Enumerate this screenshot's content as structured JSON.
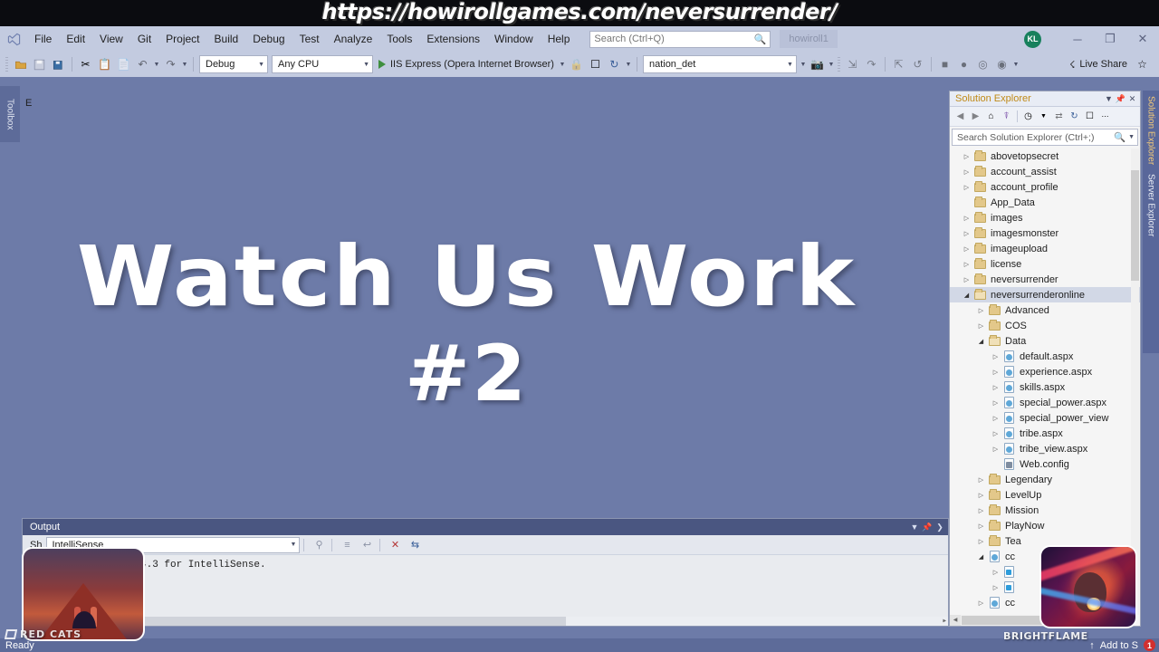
{
  "banner": {
    "url": "https://howirollgames.com/neversurrender/"
  },
  "menubar": {
    "logo_icon": "visual-studio-logo-icon",
    "items": [
      "File",
      "Edit",
      "View",
      "Git",
      "Project",
      "Build",
      "Debug",
      "Test",
      "Analyze",
      "Tools",
      "Extensions",
      "Window",
      "Help"
    ],
    "search_placeholder": "Search (Ctrl+Q)",
    "search_icon": "search-icon",
    "project_name": "howiroll1",
    "avatar_initials": "KL",
    "window_minimize": "─",
    "window_restore": "❐",
    "window_close": "✕"
  },
  "toolbar": {
    "icons": [
      "open-file-icon",
      "save-icon",
      "save-all-icon",
      "cut-icon",
      "copy-icon",
      "paste-icon",
      "undo-icon",
      "redo-icon"
    ],
    "config_value": "Debug",
    "platform_value": "Any CPU",
    "run_label": "IIS Express (Opera Internet Browser)",
    "startup_value": "nation_det",
    "live_share_label": "Live Share",
    "live_share_icon": "live-share-icon"
  },
  "workspace": {
    "toolbox_tab": "Toolbox",
    "hero_line1": "Watch Us Work",
    "hero_line2": "#2"
  },
  "solution_explorer": {
    "title": "Solution Explorer",
    "title_color": "#c08a17",
    "dropdown_icon": "chevron-down-icon",
    "pin_icon": "pin-icon",
    "close_icon": "close-icon",
    "toolbar_icons": [
      "back-icon",
      "forward-icon",
      "home-icon",
      "pending-changes-icon",
      "preview-icon",
      "sync-icon",
      "refresh-icon",
      "collapse-all-icon",
      "properties-icon"
    ],
    "search_placeholder": "Search Solution Explorer (Ctrl+;)",
    "search_icon": "search-icon",
    "tree": [
      {
        "label": "abovetopsecret",
        "indent": 1,
        "icon": "folder",
        "arrow": "closed"
      },
      {
        "label": "account_assist",
        "indent": 1,
        "icon": "folder",
        "arrow": "closed"
      },
      {
        "label": "account_profile",
        "indent": 1,
        "icon": "folder",
        "arrow": "closed"
      },
      {
        "label": "App_Data",
        "indent": 1,
        "icon": "folder",
        "arrow": "none"
      },
      {
        "label": "images",
        "indent": 1,
        "icon": "folder",
        "arrow": "closed"
      },
      {
        "label": "imagesmonster",
        "indent": 1,
        "icon": "folder",
        "arrow": "closed"
      },
      {
        "label": "imageupload",
        "indent": 1,
        "icon": "folder",
        "arrow": "closed"
      },
      {
        "label": "license",
        "indent": 1,
        "icon": "folder",
        "arrow": "closed"
      },
      {
        "label": "neversurrender",
        "indent": 1,
        "icon": "folder",
        "arrow": "closed"
      },
      {
        "label": "neversurrenderonline",
        "indent": 1,
        "icon": "folder-open",
        "arrow": "open",
        "selected": true
      },
      {
        "label": "Advanced",
        "indent": 2,
        "icon": "folder",
        "arrow": "closed"
      },
      {
        "label": "COS",
        "indent": 2,
        "icon": "folder",
        "arrow": "closed"
      },
      {
        "label": "Data",
        "indent": 2,
        "icon": "folder-open",
        "arrow": "open"
      },
      {
        "label": "default.aspx",
        "indent": 3,
        "icon": "aspx",
        "arrow": "closed"
      },
      {
        "label": "experience.aspx",
        "indent": 3,
        "icon": "aspx",
        "arrow": "closed"
      },
      {
        "label": "skills.aspx",
        "indent": 3,
        "icon": "aspx",
        "arrow": "closed"
      },
      {
        "label": "special_power.aspx",
        "indent": 3,
        "icon": "aspx",
        "arrow": "closed"
      },
      {
        "label": "special_power_view",
        "indent": 3,
        "icon": "aspx",
        "arrow": "closed"
      },
      {
        "label": "tribe.aspx",
        "indent": 3,
        "icon": "aspx",
        "arrow": "closed"
      },
      {
        "label": "tribe_view.aspx",
        "indent": 3,
        "icon": "aspx",
        "arrow": "closed"
      },
      {
        "label": "Web.config",
        "indent": 3,
        "icon": "config",
        "arrow": "none"
      },
      {
        "label": "Legendary",
        "indent": 2,
        "icon": "folder",
        "arrow": "closed"
      },
      {
        "label": "LevelUp",
        "indent": 2,
        "icon": "folder",
        "arrow": "closed"
      },
      {
        "label": "Mission",
        "indent": 2,
        "icon": "folder",
        "arrow": "closed"
      },
      {
        "label": "PlayNow",
        "indent": 2,
        "icon": "folder",
        "arrow": "closed"
      },
      {
        "label": "Tea",
        "indent": 2,
        "icon": "folder",
        "arrow": "closed"
      },
      {
        "label": "cc",
        "indent": 2,
        "icon": "aspx",
        "arrow": "open"
      },
      {
        "label": "",
        "indent": 3,
        "icon": "upload",
        "arrow": "closed"
      },
      {
        "label": "",
        "indent": 3,
        "icon": "upload",
        "arrow": "closed"
      },
      {
        "label": "cc",
        "indent": 2,
        "icon": "aspx",
        "arrow": "closed"
      }
    ],
    "side_tabs": [
      "Solution Explorer",
      "Server Explorer"
    ]
  },
  "output": {
    "title": "Output",
    "dropdown_icon": "chevron-down-icon",
    "pin_icon": "pin-icon",
    "close_icon": "close-icon",
    "show_label": "Sh",
    "source_value": "IntelliSense",
    "tool_icons": [
      "find-icon",
      "clear-all-icon",
      "word-wrap-icon",
      "clear-output-icon",
      "toggle-icon"
    ],
    "console_line": "4.3 for IntelliSense.",
    "partial_text": "E"
  },
  "statusbar": {
    "ready_text": "Ready",
    "source_control_text": "Add to S",
    "source_control_icon": "arrow-up-icon",
    "badge_count": "1"
  },
  "watermarks": {
    "left": "RED CATS",
    "right": "BRIGHTFLAME"
  }
}
